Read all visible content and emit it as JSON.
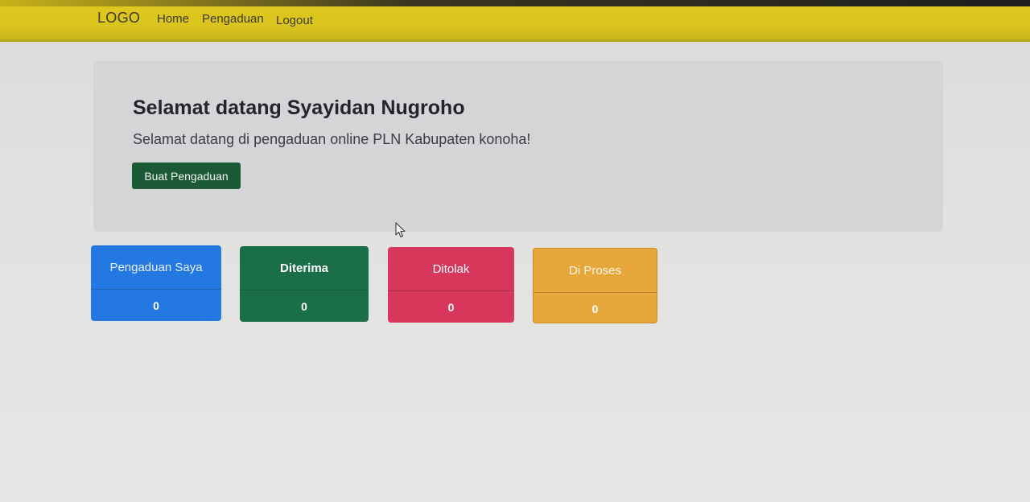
{
  "navbar": {
    "brand": "LOGO",
    "links": [
      "Home",
      "Pengaduan",
      "Logout"
    ],
    "background_color": "#d9c41e"
  },
  "jumbotron": {
    "title": "Selamat datang Syayidan Nugroho",
    "lead": "Selamat datang di pengaduan online PLN Kabupaten konoha!",
    "button_label": "Buat Pengaduan",
    "button_color": "#1b5a35"
  },
  "cards": [
    {
      "label": "Pengaduan Saya",
      "count": "0",
      "color": "#2478e2"
    },
    {
      "label": "Diterima",
      "count": "0",
      "color": "#1a6e48"
    },
    {
      "label": "Ditolak",
      "count": "0",
      "color": "#d6375a"
    },
    {
      "label": "Di Proses",
      "count": "0",
      "color": "#e8a73a"
    }
  ],
  "cursor_icon": "mouse-pointer-icon"
}
